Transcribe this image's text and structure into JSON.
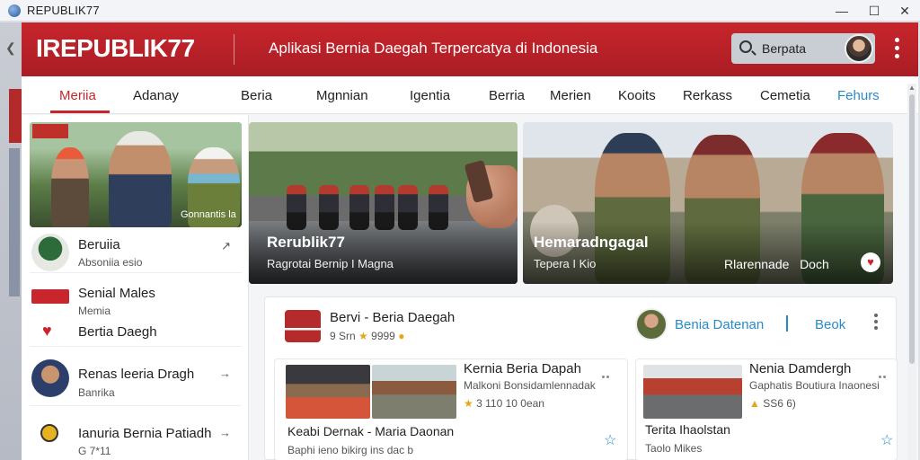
{
  "window": {
    "title": "REPUBLIK77"
  },
  "header": {
    "logo": "IREPUBLIK77",
    "tagline": "Aplikasi Bernia Daegah Terpercatya di Indonesia",
    "search_text": "Berpata"
  },
  "tabs": [
    {
      "label": "Meriia"
    },
    {
      "label": "Adanay"
    },
    {
      "label": "Beria"
    },
    {
      "label": "Mgnnian"
    },
    {
      "label": "Igentia"
    },
    {
      "label": "Berria"
    },
    {
      "label": "Merien"
    },
    {
      "label": "Kooits"
    },
    {
      "label": "Rerkass"
    },
    {
      "label": "Cemetia"
    },
    {
      "label": "Fehurs"
    }
  ],
  "sidebar": {
    "thumb_caption": "Gonnantis la",
    "items": [
      {
        "title": "Beruiia",
        "subtitle": "Absoniia esio"
      },
      {
        "title": "Senial Males",
        "subtitle": "Memia"
      },
      {
        "title": "Bertia Daegh",
        "subtitle": ""
      },
      {
        "title": "Renas leeria Dragh",
        "subtitle": "Banrika"
      },
      {
        "title": "Ianuria Bernia Patiadh",
        "subtitle": "G 7*11"
      }
    ]
  },
  "heroes": [
    {
      "title": "Rerublik77",
      "subtitle": "Ragrotai Bernip I Magna"
    },
    {
      "title": "Hemaradngagal",
      "subtitle": "Tepera I Kio",
      "right": "Rlarennade",
      "right2": "Doch"
    }
  ],
  "feed": {
    "publisher": "Bervi - Beria Daegah",
    "stat": "9 Srn",
    "stat_value": "9999",
    "follower_link": "Benia Datenan",
    "action_link": "Beok",
    "cards": [
      {
        "title": "Kernia Beria Dapah",
        "desc": "Malkoni Bonsidamlennadak",
        "stat": "3 110 10 0ean",
        "footer": "Keabi Dernak - Maria Daonan",
        "footer2": "Baphi ieno bikirg ins dac b"
      },
      {
        "title": "Nenia Damdergh",
        "desc": "Gaphatis Boutiura Inaonesi",
        "stat": "SS6 6)",
        "footer": "Terita Ihaolstan",
        "footer2": "Taolo Mikes"
      }
    ]
  }
}
